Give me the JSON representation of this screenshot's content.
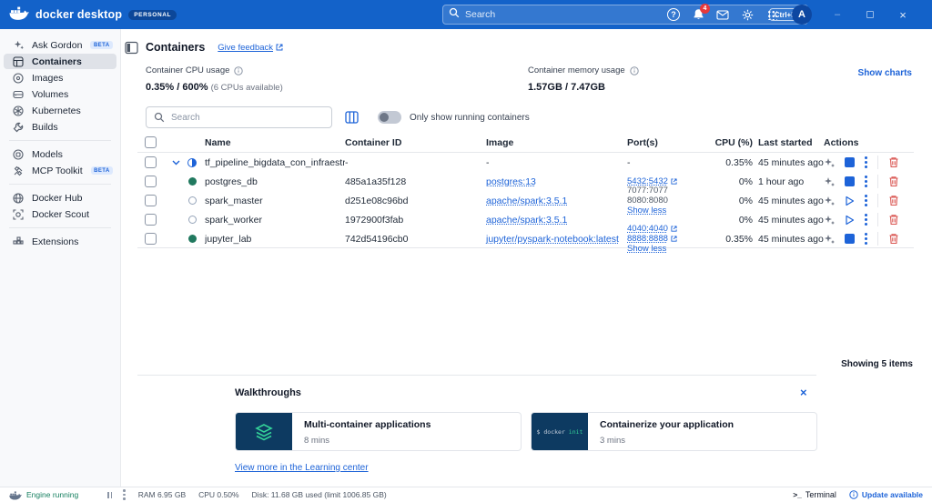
{
  "titlebar": {
    "app_name": "docker desktop",
    "plan_badge": "PERSONAL",
    "search": {
      "placeholder": "Search",
      "shortcut": "Ctrl+K"
    },
    "notification_count": "4",
    "avatar_initial": "A"
  },
  "sidebar": {
    "groups": [
      {
        "items": [
          {
            "label": "Ask Gordon",
            "badge": "BETA"
          },
          {
            "label": "Containers"
          },
          {
            "label": "Images"
          },
          {
            "label": "Volumes"
          },
          {
            "label": "Kubernetes"
          },
          {
            "label": "Builds"
          }
        ]
      },
      {
        "items": [
          {
            "label": "Models"
          },
          {
            "label": "MCP Toolkit",
            "badge": "BETA"
          }
        ]
      },
      {
        "items": [
          {
            "label": "Docker Hub"
          },
          {
            "label": "Docker Scout"
          }
        ]
      },
      {
        "items": [
          {
            "label": "Extensions"
          }
        ]
      }
    ]
  },
  "page": {
    "title": "Containers",
    "feedback_link": "Give feedback"
  },
  "stats": {
    "cpu_label": "Container CPU usage",
    "cpu_value": "0.35% / 600%",
    "cpu_note": "(6 CPUs available)",
    "memory_label": "Container memory usage",
    "memory_value": "1.57GB / 7.47GB",
    "show_charts": "Show charts"
  },
  "filters": {
    "search_placeholder": "Search",
    "running_toggle_label": "Only show running containers"
  },
  "table": {
    "columns": {
      "name": "Name",
      "container_id": "Container ID",
      "image": "Image",
      "ports": "Port(s)",
      "cpu": "CPU (%)",
      "last_started": "Last started",
      "actions": "Actions"
    },
    "rows": [
      {
        "name": "tf_pipeline_bigdata_con_infraestructuradock",
        "container_id": "-",
        "image": "-",
        "ports_dash": "-",
        "cpu": "0.35%",
        "last_started": "45 minutes ago",
        "state": "partial",
        "action": "stop"
      },
      {
        "name": "postgres_db",
        "container_id": "485a1a35f128",
        "image": "postgres:13",
        "ports": [
          "5432:5432"
        ],
        "cpu": "0%",
        "last_started": "1 hour ago",
        "state": "running",
        "action": "stop"
      },
      {
        "name": "spark_master",
        "container_id": "d251e08c96bd",
        "image": "apache/spark:3.5.1",
        "ports": [
          "7077:7077",
          "8080:8080"
        ],
        "show_less": "Show less",
        "cpu": "0%",
        "last_started": "45 minutes ago",
        "state": "stopped",
        "action": "start"
      },
      {
        "name": "spark_worker",
        "container_id": "1972900f3fab",
        "image": "apache/spark:3.5.1",
        "ports": [],
        "cpu": "0%",
        "last_started": "45 minutes ago",
        "state": "stopped",
        "action": "start"
      },
      {
        "name": "jupyter_lab",
        "container_id": "742d54196cb0",
        "image": "jupyter/pyspark-notebook:latest",
        "ports": [
          "4040:4040",
          "8888:8888"
        ],
        "show_less": "Show less",
        "cpu": "0.35%",
        "last_started": "45 minutes ago",
        "state": "running",
        "action": "stop"
      }
    ],
    "summary": "Showing 5 items"
  },
  "walkthroughs": {
    "title": "Walkthroughs",
    "cards": [
      {
        "title": "Multi-container applications",
        "duration": "8 mins"
      },
      {
        "title": "Containerize your application",
        "duration": "3 mins",
        "tile_prefix": "$ docker ",
        "tile_accent": "init"
      }
    ],
    "more_link": "View more in the Learning center"
  },
  "statusbar": {
    "engine_status": "Engine running",
    "ram": "RAM 6.95 GB",
    "cpu": "CPU 0.50%",
    "disk": "Disk: 11.68 GB used (limit 1006.85 GB)",
    "terminal": "Terminal",
    "update": "Update available"
  },
  "colors": {
    "titlebar_blue": "#1362c9",
    "accent_blue": "#1d63d8",
    "running_green": "#21795f",
    "engine_green": "#157f5f",
    "navy_tile": "#0d3a61",
    "tile_green": "#34d399",
    "delete_red": "#d9534f",
    "badge_red": "#e5393c"
  }
}
